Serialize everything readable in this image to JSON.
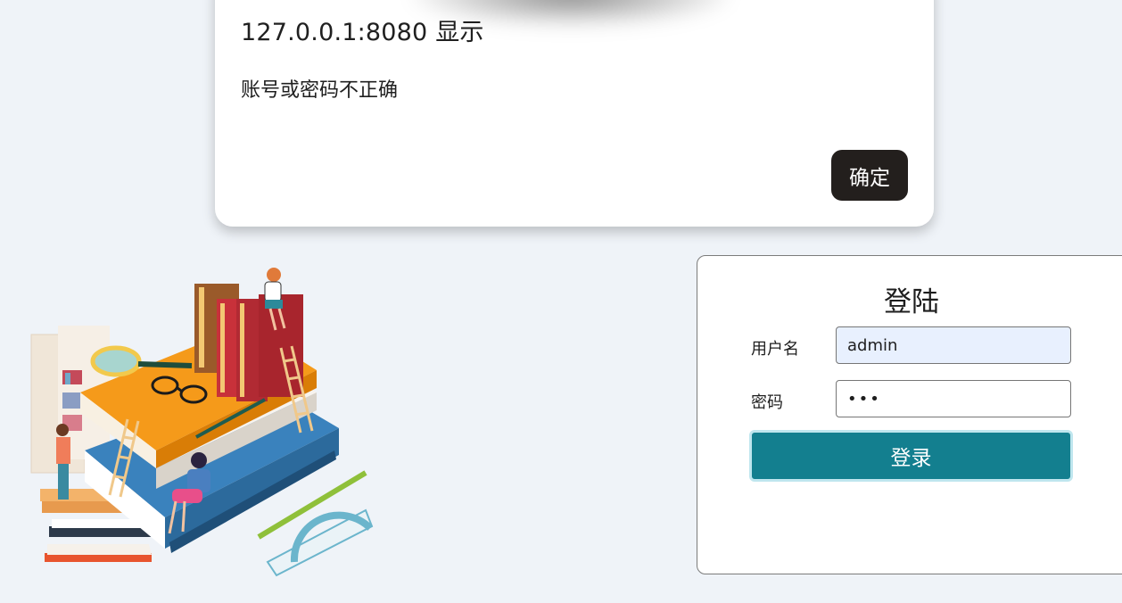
{
  "alert": {
    "title": "127.0.0.1:8080 显示",
    "message": "账号或密码不正确",
    "ok_label": "确定"
  },
  "login": {
    "title": "登陆",
    "username_label": "用户名",
    "username_value": "admin",
    "password_label": "密码",
    "password_value": "•••",
    "submit_label": "登录"
  },
  "colors": {
    "page_background": "#eff3f8",
    "login_button": "#137f8f",
    "alert_button": "#231f1d",
    "autofill_input": "#e8f0fe"
  }
}
